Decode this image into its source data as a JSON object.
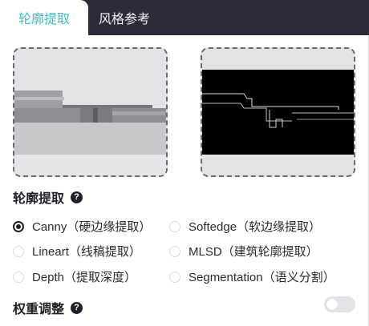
{
  "tabs": [
    {
      "label": "轮廓提取",
      "active": true
    },
    {
      "label": "风格参考",
      "active": false
    }
  ],
  "images": {
    "left": {
      "icon": "reference-photo"
    },
    "right": {
      "icon": "edge-map-preview"
    }
  },
  "section": {
    "title": "轮廓提取",
    "help": "?"
  },
  "options": [
    {
      "label": "Canny（硬边缘提取）",
      "checked": true
    },
    {
      "label": "Softedge（软边缘提取）",
      "checked": false
    },
    {
      "label": "Lineart（线稿提取）",
      "checked": false
    },
    {
      "label": "MLSD（建筑轮廓提取）",
      "checked": false
    },
    {
      "label": "Depth（提取深度）",
      "checked": false
    },
    {
      "label": "Segmentation（语义分割）",
      "checked": false
    }
  ],
  "weight": {
    "title": "权重调整",
    "help": "?",
    "enabled": false
  },
  "colors": {
    "accent": "#3fbcc4",
    "tabbar": "#2b2b3a",
    "text": "#1f1f28"
  }
}
